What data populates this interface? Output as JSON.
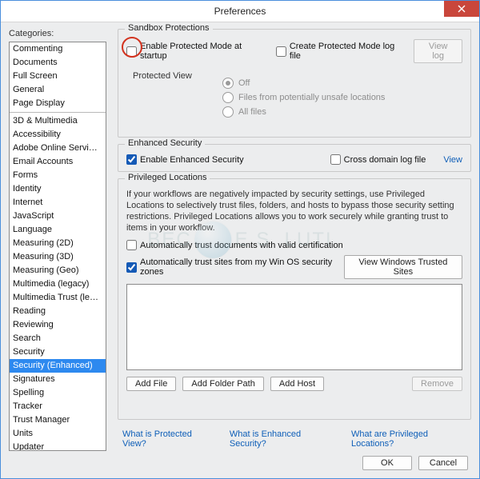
{
  "window": {
    "title": "Preferences"
  },
  "left_label": "Categories:",
  "categories": [
    "Commenting",
    "Documents",
    "Full Screen",
    "General",
    "Page Display",
    "__SEP__",
    "3D & Multimedia",
    "Accessibility",
    "Adobe Online Services",
    "Email Accounts",
    "Forms",
    "Identity",
    "Internet",
    "JavaScript",
    "Language",
    "Measuring (2D)",
    "Measuring (3D)",
    "Measuring (Geo)",
    "Multimedia (legacy)",
    "Multimedia Trust (legacy)",
    "Reading",
    "Reviewing",
    "Search",
    "Security",
    "Security (Enhanced)",
    "Signatures",
    "Spelling",
    "Tracker",
    "Trust Manager",
    "Units",
    "Updater"
  ],
  "selected_category": "Security (Enhanced)",
  "sandbox": {
    "title": "Sandbox Protections",
    "enable_pm": {
      "label": "Enable Protected Mode at startup",
      "checked": false,
      "highlighted": true
    },
    "create_pm_log": {
      "label": "Create Protected Mode log file",
      "checked": false
    },
    "view_log": "View log",
    "pv_label": "Protected View",
    "pv_options": [
      "Off",
      "Files from potentially unsafe locations",
      "All files"
    ],
    "pv_selected": 0
  },
  "enhanced": {
    "title": "Enhanced Security",
    "enable": {
      "label": "Enable Enhanced Security",
      "checked": true
    },
    "cross_log": {
      "label": "Cross domain log file",
      "checked": false
    },
    "view": "View"
  },
  "priv": {
    "title": "Privileged Locations",
    "desc": "If your workflows are negatively impacted by security settings, use Privileged Locations to selectively trust files, folders, and hosts to bypass those security setting restrictions. Privileged Locations allows you to work securely while granting trust to items in your workflow.",
    "auto_cert": {
      "label": "Automatically trust documents with valid certification",
      "checked": false
    },
    "auto_os": {
      "label": "Automatically trust sites from my Win OS security zones",
      "checked": true
    },
    "view_trusted": "View Windows Trusted Sites",
    "add_file": "Add File",
    "add_folder": "Add Folder Path",
    "add_host": "Add Host",
    "remove": "Remove"
  },
  "help_links": {
    "pv": "What is Protected View?",
    "es": "What is Enhanced Security?",
    "pl": "What are Privileged Locations?"
  },
  "footer": {
    "ok": "OK",
    "cancel": "Cancel"
  }
}
